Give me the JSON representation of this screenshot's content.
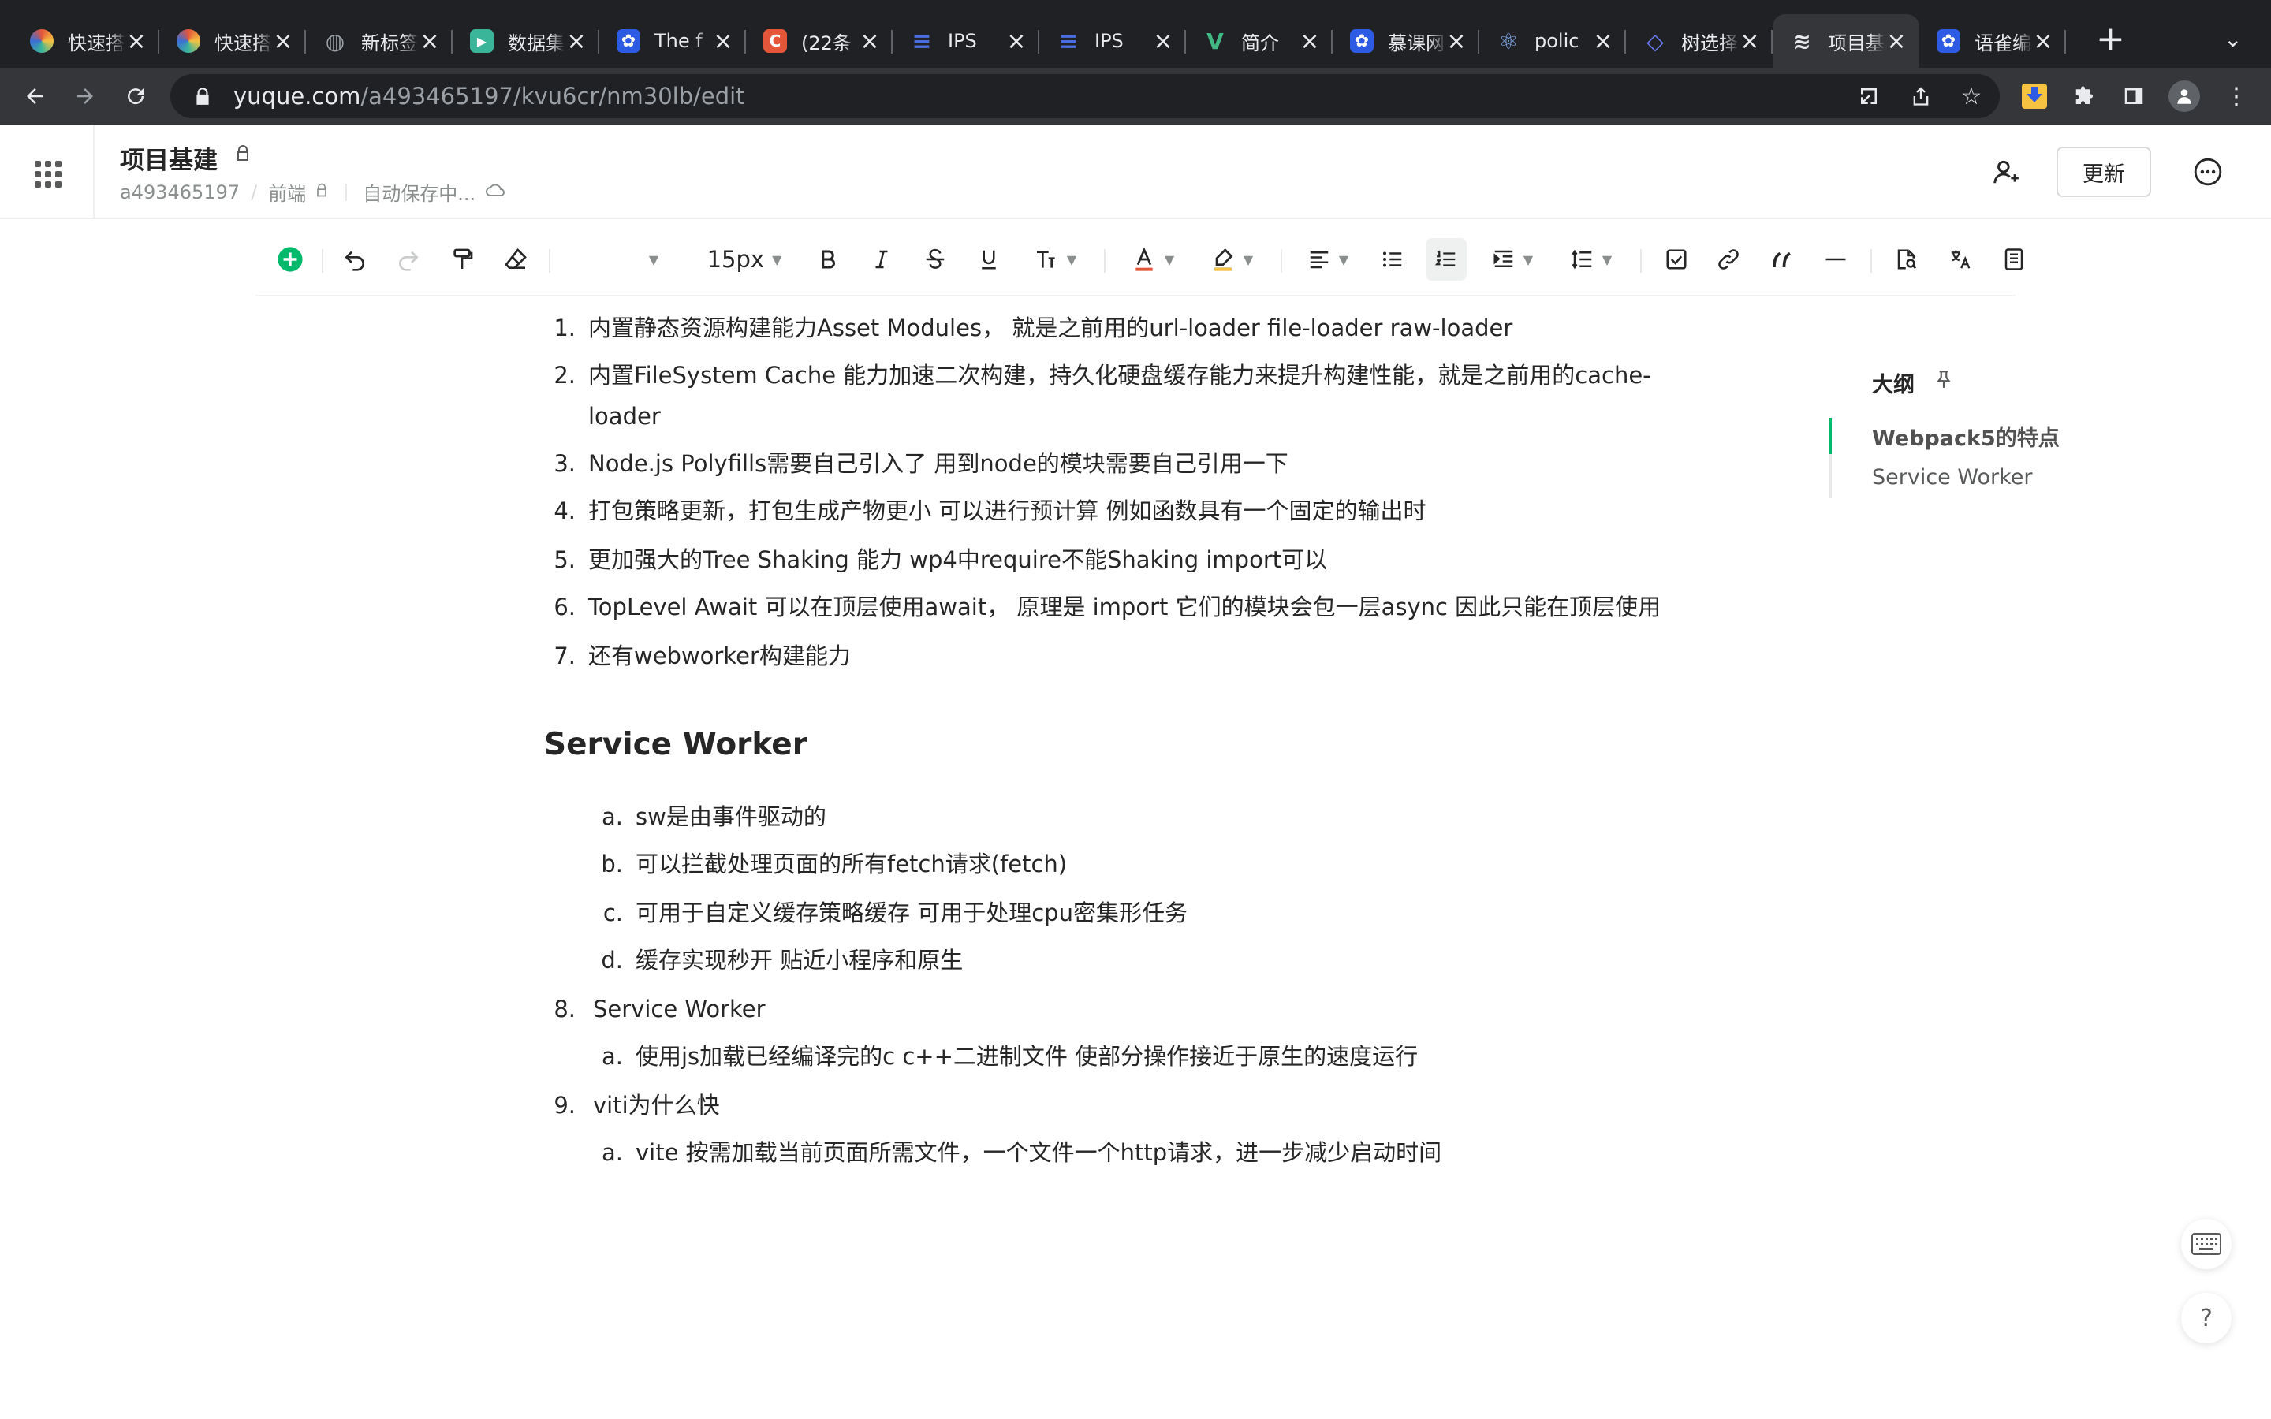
{
  "browser": {
    "tabs": [
      {
        "title": "快速搭建",
        "favicon": "colorful-orb-icon",
        "color": "#3b6fd6"
      },
      {
        "title": "快速搭建",
        "favicon": "colorful-orb-icon",
        "color": "#3b6fd6"
      },
      {
        "title": "新标签页",
        "favicon": "globe-icon",
        "color": "#9aa0a6"
      },
      {
        "title": "数据集",
        "favicon": "play-icon",
        "color": "#3bb59a"
      },
      {
        "title": "The f",
        "favicon": "baidu-paw-icon",
        "color": "#2d5be3"
      },
      {
        "title": "(22条",
        "favicon": "csdn-c-icon",
        "color": "#e5553a"
      },
      {
        "title": "IPS",
        "favicon": "stack-icon",
        "color": "#4a6ee0"
      },
      {
        "title": "IPS",
        "favicon": "stack-icon",
        "color": "#4a6ee0"
      },
      {
        "title": "简介",
        "favicon": "vue-icon",
        "color": "#41b883"
      },
      {
        "title": "慕课网",
        "favicon": "baidu-paw-icon",
        "color": "#2d5be3"
      },
      {
        "title": "polic",
        "favicon": "react-atom-icon",
        "color": "#8ab4f8"
      },
      {
        "title": "树选择",
        "favicon": "diamond-code-icon",
        "color": "#6b7cf6"
      },
      {
        "title": "项目基建",
        "favicon": "yuque-icon",
        "color": "#e8eaed",
        "active": true
      },
      {
        "title": "语雀编",
        "favicon": "baidu-paw-icon",
        "color": "#2d5be3"
      }
    ],
    "url_host": "yuque.com",
    "url_path": "/a493465197/kvu6cr/nm30lb/edit"
  },
  "header": {
    "title": "项目基建",
    "breadcrumb": {
      "user": "a493465197",
      "book": "前端",
      "status": "自动保存中..."
    },
    "update_label": "更新"
  },
  "toolbar": {
    "font_size": "15px"
  },
  "doc": {
    "list1": [
      {
        "num": "1.",
        "text": "内置静态资源构建能力Asset Modules， 就是之前用的url-loader file-loader raw-loader"
      },
      {
        "num": "2.",
        "text": "内置FileSystem Cache 能力加速二次构建，持久化硬盘缓存能力来提升构建性能，就是之前用的cache-",
        "cont": "loader"
      },
      {
        "num": "3.",
        "text": "Node.js Polyfills需要自己引入了 用到node的模块需要自己引用一下"
      },
      {
        "num": "4.",
        "text": "打包策略更新，打包生成产物更小 可以进行预计算 例如函数具有一个固定的输出时"
      },
      {
        "num": "5.",
        "text": "更加强大的Tree Shaking 能力 wp4中require不能Shaking import可以"
      },
      {
        "num": "6.",
        "text": "TopLevel Await 可以在顶层使用await， 原理是 import 它们的模块会包一层async 因此只能在顶层使用"
      },
      {
        "num": "7.",
        "text": "还有webworker构建能力"
      }
    ],
    "heading": "Service Worker",
    "sublist_a": [
      {
        "num": "a.",
        "text": "sw是由事件驱动的"
      },
      {
        "num": "b.",
        "text": "可以拦截处理页面的所有fetch请求(fetch)"
      },
      {
        "num": "c.",
        "text": "可用于自定义缓存策略缓存 可用于处理cpu密集形任务"
      },
      {
        "num": "d.",
        "text": "缓存实现秒开 贴近小程序和原生"
      }
    ],
    "item8": {
      "num": "8.",
      "text": "Service Worker"
    },
    "item8_sub": {
      "num": "a.",
      "text": "使用js加载已经编译完的c c++二进制文件 使部分操作接近于原生的速度运行"
    },
    "item9": {
      "num": "9.",
      "text": "viti为什么快"
    },
    "item9_sub": {
      "num": "a.",
      "text": "vite 按需加载当前页面所需文件，一个文件一个http请求，进一步减少启动时间"
    }
  },
  "outline": {
    "title": "大纲",
    "items": [
      "Webpack5的特点",
      "Service Worker"
    ]
  },
  "colors": {
    "accent": "#00b96b",
    "chrome_dark": "#202124"
  }
}
